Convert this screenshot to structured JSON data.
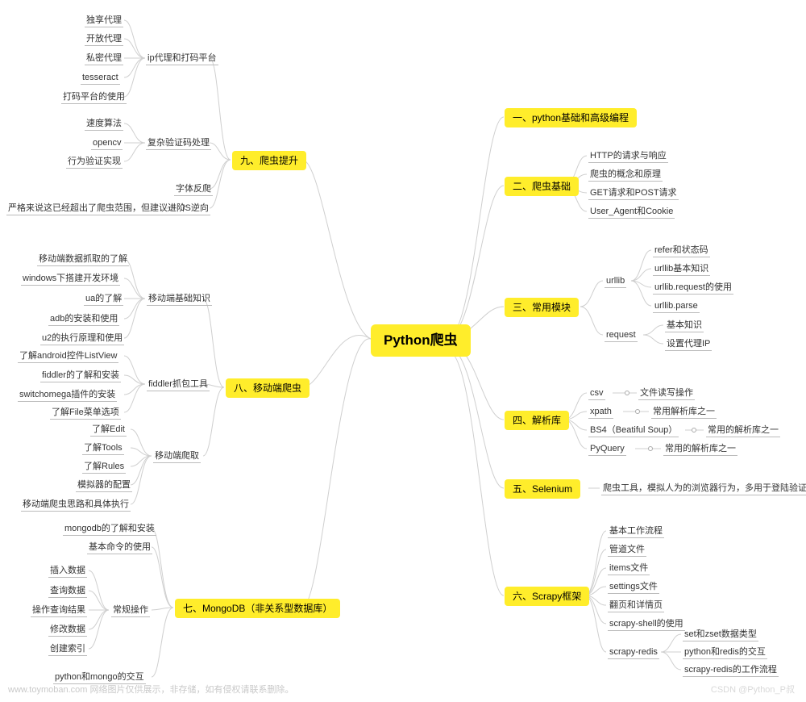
{
  "root": "Python爬虫",
  "branches": {
    "b1": {
      "label": "一、python基础和高级编程"
    },
    "b2": {
      "label": "二、爬虫基础",
      "children": [
        "HTTP的请求与响应",
        "爬虫的概念和原理",
        "GET请求和POST请求",
        "User_Agent和Cookie"
      ]
    },
    "b3": {
      "label": "三、常用模块",
      "children": [
        {
          "label": "urllib",
          "children": [
            "refer和状态码",
            "urllib基本知识",
            "urllib.request的使用",
            "urllib.parse"
          ]
        },
        {
          "label": "request",
          "children": [
            "基本知识",
            "设置代理IP"
          ]
        }
      ]
    },
    "b4": {
      "label": "四、解析库",
      "children": [
        {
          "label": "csv",
          "note": "文件读写操作"
        },
        {
          "label": "xpath",
          "note": "常用解析库之一"
        },
        {
          "label": "BS4（Beatiful Soup）",
          "note": "常用的解析库之一"
        },
        {
          "label": "PyQuery",
          "note": "常用的解析库之一"
        }
      ]
    },
    "b5": {
      "label": "五、Selenium",
      "note": "爬虫工具，模拟人为的浏览器行为，多用于登陆验证"
    },
    "b6": {
      "label": "六、Scrapy框架",
      "children": [
        "基本工作流程",
        "管道文件",
        "items文件",
        "settings文件",
        "翻页和详情页",
        "scrapy-shell的使用",
        {
          "label": "scrapy-redis",
          "children": [
            "set和zset数据类型",
            "python和redis的交互",
            "scrapy-redis的工作流程"
          ]
        }
      ]
    },
    "b7": {
      "label": "七、MongoDB（非关系型数据库）",
      "children": [
        "mongodb的了解和安装",
        "基本命令的使用",
        {
          "label": "常规操作",
          "children": [
            "插入数据",
            "查询数据",
            "操作查询结果",
            "修改数据",
            "创建索引"
          ]
        },
        "python和mongo的交互"
      ]
    },
    "b8": {
      "label": "八、移动端爬虫",
      "children": [
        {
          "label": "移动端基础知识",
          "children": [
            "移动端数据抓取的了解",
            "windows下搭建开发环境",
            "ua的了解",
            "adb的安装和使用",
            "u2的执行原理和使用"
          ]
        },
        {
          "label": "fiddler抓包工具",
          "children": [
            "了解android控件ListView",
            "fiddler的了解和安装",
            "switchomega插件的安装",
            "了解File菜单选项"
          ]
        },
        {
          "label": "移动端爬取",
          "children": [
            "了解Edit",
            "了解Tools",
            "了解Rules",
            "模拟器的配置",
            "移动端爬虫思路和具体执行"
          ]
        }
      ]
    },
    "b9": {
      "label": "九、爬虫提升",
      "children": [
        {
          "label": "ip代理和打码平台",
          "children": [
            "独享代理",
            "开放代理",
            "私密代理",
            "tesseract",
            "打码平台的使用"
          ]
        },
        {
          "label": "复杂验证码处理",
          "children": [
            "速度算法",
            "opencv",
            "行为验证实现"
          ]
        },
        "字体反爬",
        {
          "label": "JS逆向",
          "note": "严格来说这已经超出了爬虫范围，但建议进阶"
        }
      ]
    }
  },
  "watermark1": "www.toymoban.com 网络图片仅供展示，非存储，如有侵权请联系删除。",
  "watermark2": "CSDN @Python_P叔"
}
